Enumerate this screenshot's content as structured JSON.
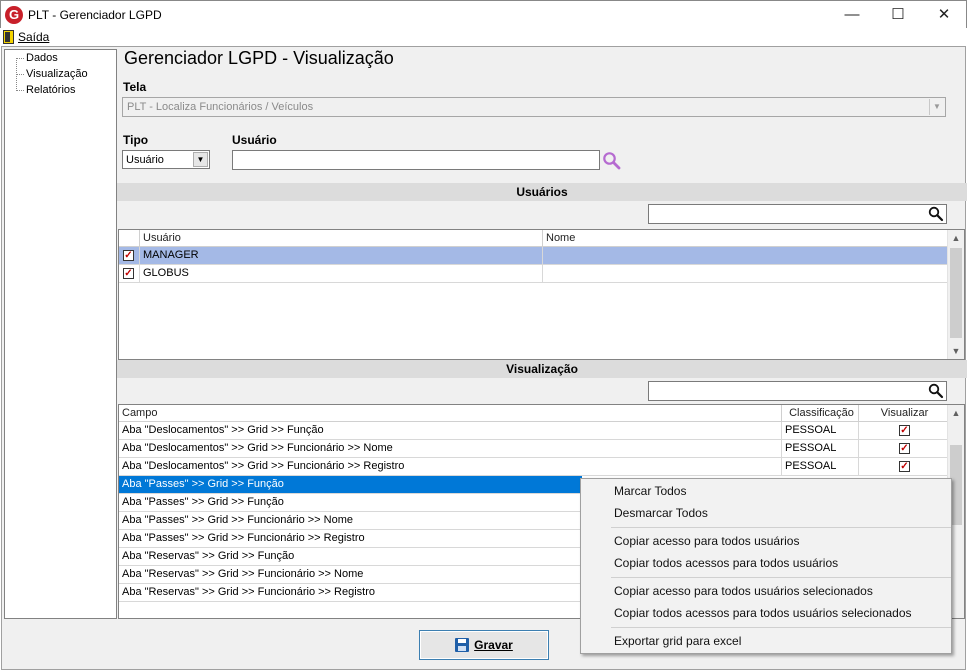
{
  "window": {
    "title": "PLT - Gerenciador LGPD",
    "controls": {
      "minimize": "—",
      "maximize": "☐",
      "close": "✕"
    }
  },
  "menu": {
    "saida": "Saída"
  },
  "tree": {
    "items": [
      "Dados",
      "Visualização",
      "Relatórios"
    ]
  },
  "page": {
    "heading": "Gerenciador LGPD - Visualização",
    "tela_label": "Tela",
    "tela_value": "PLT - Localiza Funcionários / Veículos",
    "tipo_label": "Tipo",
    "tipo_value": "Usuário",
    "usuario_label": "Usuário",
    "usuario_value": ""
  },
  "usuarios_section": {
    "title": "Usuários",
    "filter_value": "",
    "columns": [
      "Usuário",
      "Nome"
    ],
    "rows": [
      {
        "checked": true,
        "usuario": "MANAGER",
        "nome": "",
        "selected": true
      },
      {
        "checked": true,
        "usuario": "GLOBUS",
        "nome": "",
        "selected": false
      }
    ]
  },
  "visualizacao_section": {
    "title": "Visualização",
    "filter_value": "",
    "columns": [
      "Campo",
      "Classificação",
      "Visualizar"
    ],
    "rows": [
      {
        "campo": "Aba \"Deslocamentos\" >> Grid >> Função",
        "classificacao": "PESSOAL",
        "visualizar": true
      },
      {
        "campo": "Aba \"Deslocamentos\" >> Grid >> Funcionário >> Nome",
        "classificacao": "PESSOAL",
        "visualizar": true
      },
      {
        "campo": "Aba \"Deslocamentos\" >> Grid >> Funcionário >> Registro",
        "classificacao": "PESSOAL",
        "visualizar": true
      },
      {
        "campo": "Aba \"Passes\" >> Grid >> Função",
        "classificacao": "",
        "visualizar": null
      },
      {
        "campo": "Aba \"Passes\" >> Grid >> Função",
        "classificacao": "",
        "visualizar": null
      },
      {
        "campo": "Aba \"Passes\" >> Grid >> Funcionário >> Nome",
        "classificacao": "",
        "visualizar": null
      },
      {
        "campo": "Aba \"Passes\" >> Grid >> Funcionário >> Registro",
        "classificacao": "",
        "visualizar": null
      },
      {
        "campo": "Aba \"Reservas\" >> Grid >> Função",
        "classificacao": "",
        "visualizar": null
      },
      {
        "campo": "Aba \"Reservas\" >> Grid >> Funcionário >> Nome",
        "classificacao": "",
        "visualizar": null
      },
      {
        "campo": "Aba \"Reservas\" >> Grid >> Funcionário >> Registro",
        "classificacao": "",
        "visualizar": null
      }
    ]
  },
  "context_menu": {
    "items": [
      "Marcar Todos",
      "Desmarcar Todos",
      "Copiar acesso para todos usuários",
      "Copiar todos acessos para todos usuários",
      "Copiar acesso para todos usuários selecionados",
      "Copiar todos acessos para todos usuários selecionados",
      "Exportar grid para excel"
    ]
  },
  "buttons": {
    "gravar": "Gravar"
  },
  "colors": {
    "selected_row": "#a4b9e6",
    "highlight_row": "#0078d7",
    "check_mark": "#c00000",
    "search_icon": "#b56ad0"
  },
  "icons": [
    "app-logo-icon",
    "door-exit-icon",
    "search-icon",
    "magnifier-icon",
    "floppy-disk-icon"
  ]
}
